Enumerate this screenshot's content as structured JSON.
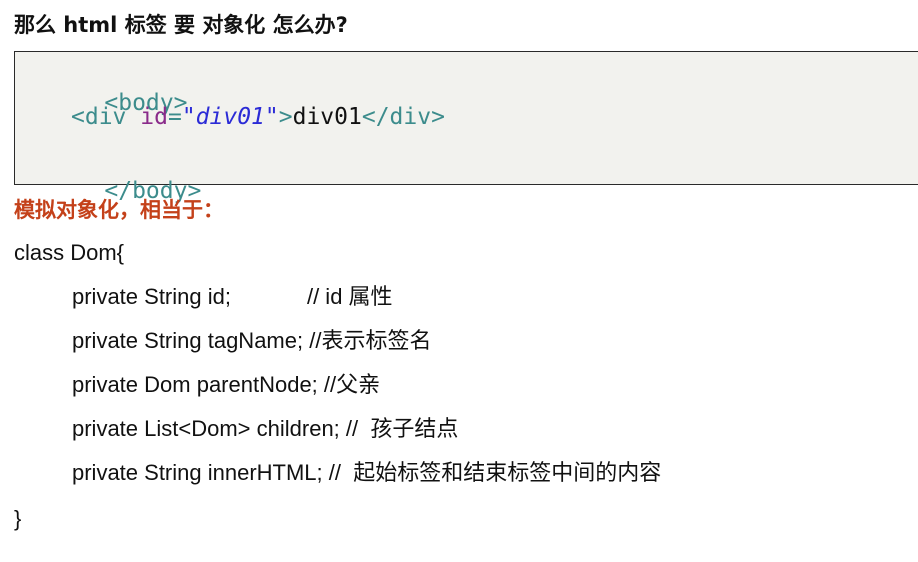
{
  "heading": "那么 html 标签 要 对象化 怎么办?",
  "html_snippet": {
    "line1_tag": "<body>",
    "line2_open": "<div",
    "line2_attr_name": "id",
    "line2_eq": "=",
    "line2_attr_value": "\"div01\"",
    "line2_close_bracket": ">",
    "line2_content": "div01",
    "line2_end_tag": "</div>",
    "line3_tag": "</body>"
  },
  "subheading": "模拟对象化，相当于：",
  "class_code": {
    "open": "class Dom{",
    "fields": [
      {
        "declaration": "private String id;",
        "comment": "// id 属性"
      },
      {
        "declaration": "private String tagName;",
        "comment": "//表示标签名"
      },
      {
        "declaration": "private Dom parentNode;",
        "comment": "//父亲"
      },
      {
        "declaration": "private List<Dom> children;",
        "comment": "//  孩子结点"
      },
      {
        "declaration": "private String innerHTML;",
        "comment": "//  起始标签和结束标签中间的内容"
      }
    ],
    "close": "}"
  }
}
